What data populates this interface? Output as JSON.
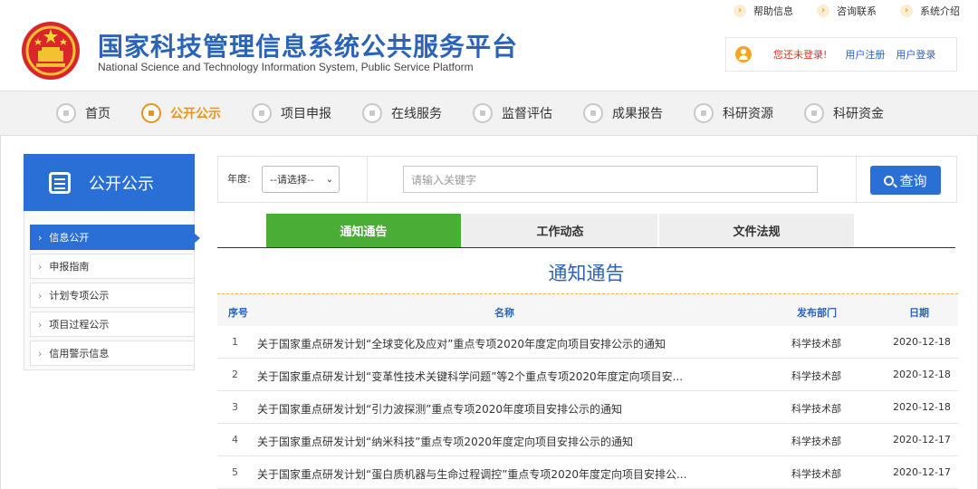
{
  "colors": {
    "primary_blue": "#2a6fd6",
    "title_blue": "#2a63b8",
    "active_orange": "#e9931a",
    "tab_green": "#4aae36",
    "alert_red": "#e0321c"
  },
  "header": {
    "title": "国家科技管理信息系统公共服务平台",
    "subtitle": "National Science and Technology Information System, Public Service Platform",
    "top_links": [
      "帮助信息",
      "咨询联系",
      "系统介绍"
    ],
    "login": {
      "status": "您还未登录!",
      "register": "用户注册",
      "login": "用户登录"
    }
  },
  "nav": [
    {
      "label": "首页",
      "icon": "home-icon"
    },
    {
      "label": "公开公示",
      "icon": "chart-icon",
      "active": true
    },
    {
      "label": "项目申报",
      "icon": "pen-icon"
    },
    {
      "label": "在线服务",
      "icon": "person-icon"
    },
    {
      "label": "监督评估",
      "icon": "star-icon"
    },
    {
      "label": "成果报告",
      "icon": "report-icon"
    },
    {
      "label": "科研资源",
      "icon": "star-icon"
    },
    {
      "label": "科研资金",
      "icon": "pen-icon"
    }
  ],
  "sidebar": {
    "title": "公开公示",
    "items": [
      "信息公开",
      "申报指南",
      "计划专项公示",
      "项目过程公示",
      "信用警示信息"
    ]
  },
  "search": {
    "year_label": "年度:",
    "year_value": "--请选择--",
    "placeholder": "请输入关键字",
    "button": "查询"
  },
  "tabs": [
    "通知通告",
    "工作动态",
    "文件法规"
  ],
  "section_title": "通知通告",
  "table": {
    "headers": {
      "no": "序号",
      "name": "名称",
      "dept": "发布部门",
      "date": "日期"
    },
    "rows": [
      {
        "no": "1",
        "name": "关于国家重点研发计划“全球变化及应对”重点专项2020年度定向项目安排公示的通知",
        "dept": "科学技术部",
        "date": "2020-12-18"
      },
      {
        "no": "2",
        "name": "关于国家重点研发计划“变革性技术关键科学问题”等2个重点专项2020年度定向项目安...",
        "dept": "科学技术部",
        "date": "2020-12-18"
      },
      {
        "no": "3",
        "name": "关于国家重点研发计划“引力波探测”重点专项2020年度项目安排公示的通知",
        "dept": "科学技术部",
        "date": "2020-12-18"
      },
      {
        "no": "4",
        "name": "关于国家重点研发计划“纳米科技”重点专项2020年度定向项目安排公示的通知",
        "dept": "科学技术部",
        "date": "2020-12-17"
      },
      {
        "no": "5",
        "name": "关于国家重点研发计划“蛋白质机器与生命过程调控”重点专项2020年度定向项目安排公...",
        "dept": "科学技术部",
        "date": "2020-12-17"
      }
    ]
  }
}
